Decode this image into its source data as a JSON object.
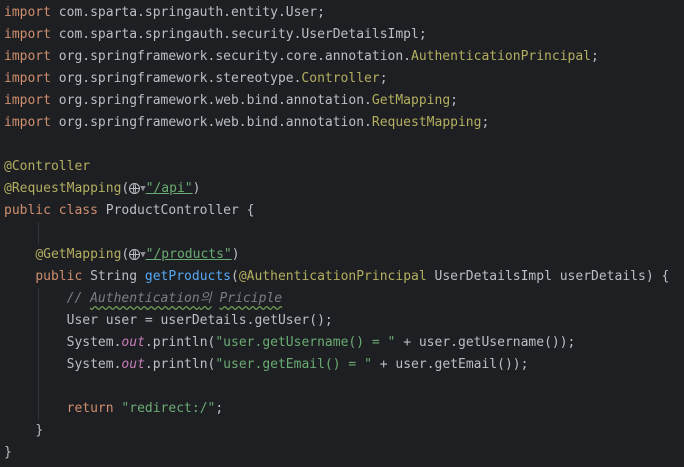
{
  "lines": {
    "l1": {
      "kw": "import",
      "rest": " com.sparta.springauth.entity.User;"
    },
    "l2": {
      "kw": "import",
      "rest": " com.sparta.springauth.security.UserDetailsImpl;"
    },
    "l3": {
      "kw": "import",
      "pkg": " org.springframework.security.core.annotation.",
      "cls": "AuthenticationPrincipal",
      "end": ";"
    },
    "l4": {
      "kw": "import",
      "pkg": " org.springframework.stereotype.",
      "cls": "Controller",
      "end": ";"
    },
    "l5": {
      "kw": "import",
      "pkg": " org.springframework.web.bind.annotation.",
      "cls": "GetMapping",
      "end": ";"
    },
    "l6": {
      "kw": "import",
      "pkg": " org.springframework.web.bind.annotation.",
      "cls": "RequestMapping",
      "end": ";"
    },
    "l8": {
      "ann": "@Controller"
    },
    "l9": {
      "ann": "@RequestMapping",
      "open": "(",
      "str": "\"/api\"",
      "close": ")"
    },
    "l10": {
      "kw": "public class",
      "rest": " ProductController {"
    },
    "l12": {
      "ann": "@GetMapping",
      "open": "(",
      "str": "\"/products\"",
      "close": ")"
    },
    "l13": {
      "kw": "public",
      "type": " String ",
      "fn": "getProducts",
      "open": "(",
      "ann": "@AuthenticationPrincipal",
      "rest": " UserDetailsImpl userDetails) {"
    },
    "l14": {
      "prefix": "// ",
      "word1": "Authentication",
      "word2": "의",
      "mid": " ",
      "word3": "Priciple"
    },
    "l15": {
      "text": "User user = userDetails.getUser();"
    },
    "l16": {
      "a": "System.",
      "out": "out",
      "b": ".println(",
      "str": "\"user.getUsername() = \"",
      "c": " + user.getUsername());"
    },
    "l17": {
      "a": "System.",
      "out": "out",
      "b": ".println(",
      "str": "\"user.getEmail() = \"",
      "c": " + user.getEmail());"
    },
    "l19": {
      "kw": "return",
      "sp": " ",
      "str": "\"redirect:/\"",
      "end": ";"
    },
    "l20": {
      "text": "}"
    },
    "l21": {
      "text": "}"
    }
  },
  "icons": {
    "web": "globe-icon",
    "dropdown": "chevron-down-icon"
  },
  "colors": {
    "background": "#1e1f22",
    "keyword": "#cf8e6d",
    "annotation": "#b3ae60",
    "string": "#6aab73",
    "method": "#56a8f5",
    "static_field": "#c77dbb",
    "comment": "#7a7e85",
    "text": "#bcbec4"
  }
}
